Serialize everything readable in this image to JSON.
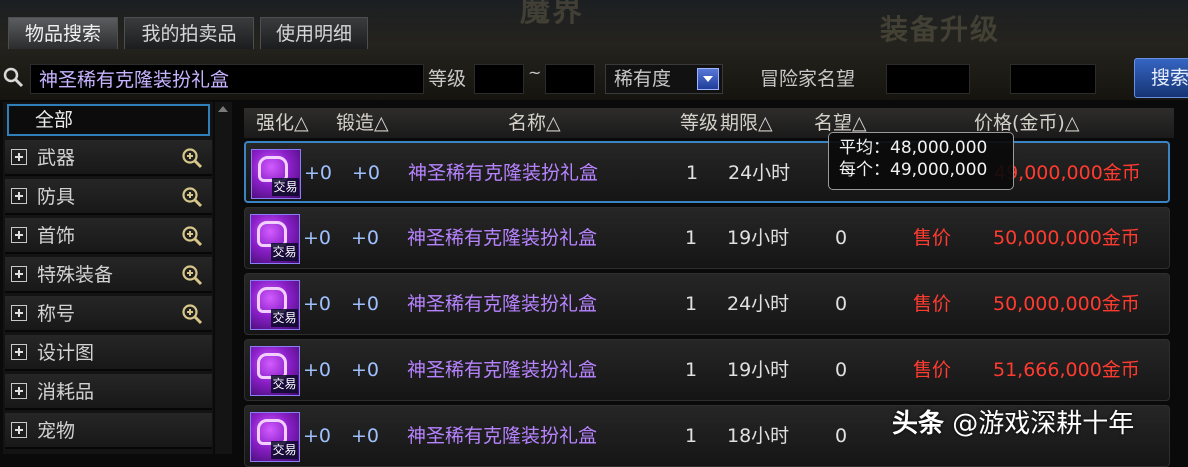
{
  "tabs": [
    "物品搜索",
    "我的拍卖品",
    "使用明细"
  ],
  "background_text": [
    "魔界",
    "装备升级"
  ],
  "search": {
    "query": "神圣稀有克隆装扮礼盒",
    "level_label": "等级",
    "range_sep": "~",
    "rarity_label": "稀有度",
    "fame_label": "冒险家名望",
    "button": "搜索"
  },
  "sidebar": {
    "all": "全部",
    "items": [
      {
        "label": "武器",
        "zoom": true
      },
      {
        "label": "防具",
        "zoom": true
      },
      {
        "label": "首饰",
        "zoom": true
      },
      {
        "label": "特殊装备",
        "zoom": true
      },
      {
        "label": "称号",
        "zoom": true
      },
      {
        "label": "设计图",
        "zoom": false
      },
      {
        "label": "消耗品",
        "zoom": false
      },
      {
        "label": "宠物",
        "zoom": false
      }
    ]
  },
  "table": {
    "headers": [
      "强化△",
      "锻造△",
      "名称△",
      "等级",
      "期限△",
      "名望△",
      "价格(金币)△"
    ],
    "icon_badge": "交易",
    "rows": [
      {
        "enh": "+0",
        "forge": "+0",
        "name": "神圣稀有克隆装扮礼盒",
        "level": "1",
        "period": "24小时",
        "fame": "",
        "tag": "",
        "price": "49,000,000金币"
      },
      {
        "enh": "+0",
        "forge": "+0",
        "name": "神圣稀有克隆装扮礼盒",
        "level": "1",
        "period": "19小时",
        "fame": "0",
        "tag": "售价",
        "price": "50,000,000金币"
      },
      {
        "enh": "+0",
        "forge": "+0",
        "name": "神圣稀有克隆装扮礼盒",
        "level": "1",
        "period": "24小时",
        "fame": "0",
        "tag": "售价",
        "price": "50,000,000金币"
      },
      {
        "enh": "+0",
        "forge": "+0",
        "name": "神圣稀有克隆装扮礼盒",
        "level": "1",
        "period": "19小时",
        "fame": "0",
        "tag": "售价",
        "price": "51,666,000金币"
      },
      {
        "enh": "+0",
        "forge": "+0",
        "name": "神圣稀有克隆装扮礼盒",
        "level": "1",
        "period": "18小时",
        "fame": "0",
        "tag": "",
        "price": ""
      }
    ]
  },
  "tooltip": {
    "line1": "平均：48,000,000",
    "line2": "每个：49,000,000"
  },
  "watermark": {
    "brand": "头条",
    "handle": "@游戏深耕十年"
  },
  "colors": {
    "accent": "#3a84c4",
    "item_name": "#b783ff",
    "price_red": "#ff3b30"
  }
}
